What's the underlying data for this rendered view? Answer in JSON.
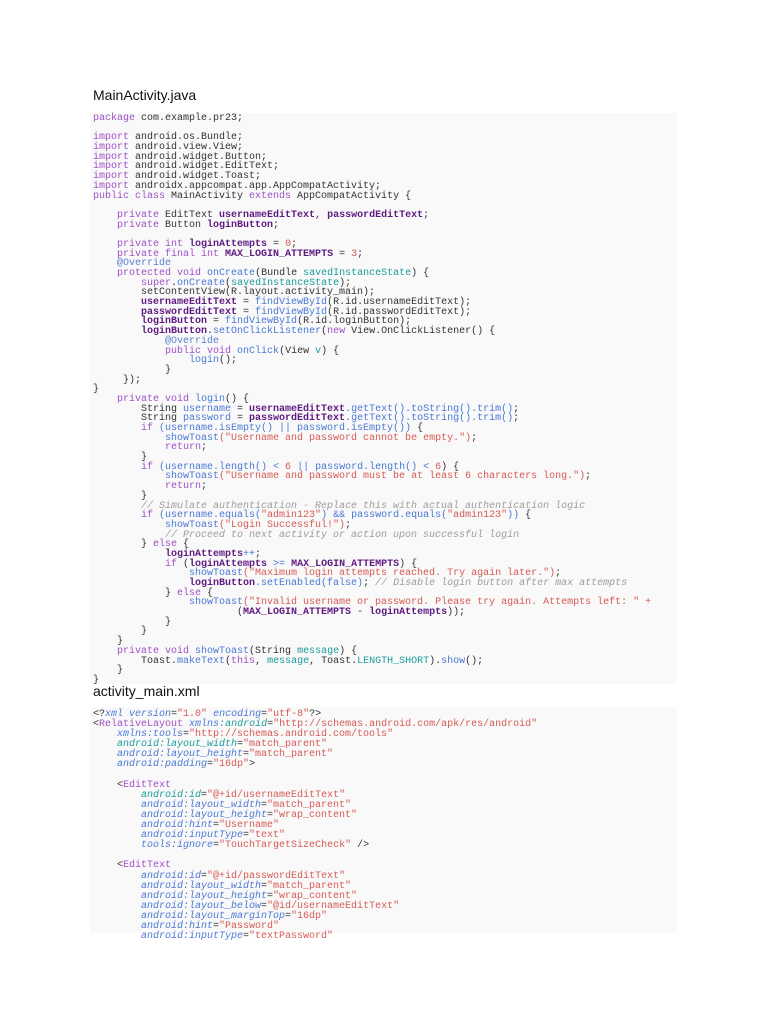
{
  "java": {
    "title": "MainActivity.java",
    "lines": [
      [
        [
          "k",
          "package"
        ],
        [
          "p",
          " com.example.pr23;"
        ]
      ],
      [],
      [
        [
          "k",
          "import"
        ],
        [
          "p",
          " android.os.Bundle;"
        ]
      ],
      [
        [
          "k",
          "import"
        ],
        [
          "p",
          " android.view.View;"
        ]
      ],
      [
        [
          "k",
          "import"
        ],
        [
          "p",
          " android.widget.Button;"
        ]
      ],
      [
        [
          "k",
          "import"
        ],
        [
          "p",
          " android.widget.EditText;"
        ]
      ],
      [
        [
          "k",
          "import"
        ],
        [
          "p",
          " android.widget.Toast;"
        ]
      ],
      [
        [
          "k",
          "import"
        ],
        [
          "p",
          " androidx.appcompat.app.AppCompatActivity;"
        ]
      ],
      [
        [
          "k",
          "public class"
        ],
        [
          "p",
          " MainActivity "
        ],
        [
          "k",
          "extends"
        ],
        [
          "p",
          " AppCompatActivity {"
        ]
      ],
      [],
      [
        [
          "k",
          "    private"
        ],
        [
          "p",
          " EditText "
        ],
        [
          "f",
          "usernameEditText"
        ],
        [
          "p",
          ", "
        ],
        [
          "f",
          "passwordEditText"
        ],
        [
          "p",
          ";"
        ]
      ],
      [
        [
          "k",
          "    private"
        ],
        [
          "p",
          " Button "
        ],
        [
          "f",
          "loginButton"
        ],
        [
          "p",
          ";"
        ]
      ],
      [],
      [
        [
          "k",
          "    private int"
        ],
        [
          "p",
          " "
        ],
        [
          "f",
          "loginAttempts"
        ],
        [
          "p",
          " = "
        ],
        [
          "n",
          "0"
        ],
        [
          "p",
          ";"
        ]
      ],
      [
        [
          "k",
          "    private final int"
        ],
        [
          "p",
          " "
        ],
        [
          "f",
          "MAX_LOGIN_ATTEMPTS"
        ],
        [
          "p",
          " = "
        ],
        [
          "n",
          "3"
        ],
        [
          "p",
          ";"
        ]
      ],
      [
        [
          "o",
          "    @Override"
        ]
      ],
      [
        [
          "k",
          "    protected void"
        ],
        [
          "p",
          " "
        ],
        [
          "m",
          "onCreate"
        ],
        [
          "p",
          "(Bundle "
        ],
        [
          "a",
          "savedInstanceState"
        ],
        [
          "p",
          ") {"
        ]
      ],
      [
        [
          "k",
          "        super"
        ],
        [
          "p",
          "."
        ],
        [
          "m",
          "onCreate"
        ],
        [
          "p",
          "("
        ],
        [
          "a",
          "savedInstanceState"
        ],
        [
          "p",
          ");"
        ]
      ],
      [
        [
          "p",
          "        setContentView(R.layout.activity_main);"
        ]
      ],
      [
        [
          "f",
          "        usernameEditText"
        ],
        [
          "p",
          " = "
        ],
        [
          "m",
          "findViewById"
        ],
        [
          "p",
          "(R.id.usernameEditText);"
        ]
      ],
      [
        [
          "f",
          "        passwordEditText"
        ],
        [
          "p",
          " = "
        ],
        [
          "m",
          "findViewById"
        ],
        [
          "p",
          "(R.id.passwordEditText);"
        ]
      ],
      [
        [
          "f",
          "        loginButton"
        ],
        [
          "p",
          " = "
        ],
        [
          "m",
          "findViewById"
        ],
        [
          "p",
          "(R.id.loginButton);"
        ]
      ],
      [
        [
          "f",
          "        loginButton"
        ],
        [
          "p",
          "."
        ],
        [
          "m",
          "setOnClickListener"
        ],
        [
          "p",
          "("
        ],
        [
          "k",
          "new"
        ],
        [
          "p",
          " View.OnClickListener() {"
        ]
      ],
      [
        [
          "o",
          "            @Override"
        ]
      ],
      [
        [
          "k",
          "            public void"
        ],
        [
          "p",
          " "
        ],
        [
          "m",
          "onClick"
        ],
        [
          "p",
          "(View "
        ],
        [
          "a",
          "v"
        ],
        [
          "p",
          ") {"
        ]
      ],
      [
        [
          "m",
          "                login"
        ],
        [
          "p",
          "();"
        ]
      ],
      [
        [
          "p",
          "            }"
        ]
      ],
      [
        [
          "p",
          "     });"
        ]
      ],
      [
        [
          "p",
          "}"
        ]
      ],
      [
        [
          "k",
          "    private void"
        ],
        [
          "p",
          " "
        ],
        [
          "m",
          "login"
        ],
        [
          "p",
          "() {"
        ]
      ],
      [
        [
          "p",
          "        String "
        ],
        [
          "m",
          "username"
        ],
        [
          "p",
          " = "
        ],
        [
          "f",
          "usernameEditText"
        ],
        [
          "m",
          ".getText().toString().trim()"
        ],
        [
          "p",
          ";"
        ]
      ],
      [
        [
          "p",
          "        String "
        ],
        [
          "m",
          "password"
        ],
        [
          "p",
          " = "
        ],
        [
          "f",
          "passwordEditText"
        ],
        [
          "m",
          ".getText().toString().trim()"
        ],
        [
          "p",
          ";"
        ]
      ],
      [
        [
          "k",
          "        if"
        ],
        [
          "m",
          " (username.isEmpty() || password.isEmpty())"
        ],
        [
          "p",
          " {"
        ]
      ],
      [
        [
          "m",
          "            showToast"
        ],
        [
          "s",
          "(\"Username and password cannot be empty.\")"
        ],
        [
          "p",
          ";"
        ]
      ],
      [
        [
          "k",
          "            return"
        ],
        [
          "p",
          ";"
        ]
      ],
      [
        [
          "p",
          "        }"
        ]
      ],
      [
        [
          "k",
          "        if"
        ],
        [
          "m",
          " (username.length() < "
        ],
        [
          "n",
          "6"
        ],
        [
          "m",
          " || password.length() < "
        ],
        [
          "n",
          "6"
        ],
        [
          "p",
          ") {"
        ]
      ],
      [
        [
          "m",
          "            showToast"
        ],
        [
          "s",
          "(\"Username and password must be at least 6 characters long.\")"
        ],
        [
          "p",
          ";"
        ]
      ],
      [
        [
          "k",
          "            return"
        ],
        [
          "p",
          ";"
        ]
      ],
      [
        [
          "p",
          "        }"
        ]
      ],
      [
        [
          "c",
          "        // Simulate authentication - Replace this with actual authentication logic"
        ]
      ],
      [
        [
          "k",
          "        if"
        ],
        [
          "m",
          " (username.equals("
        ],
        [
          "s",
          "\"admin123\""
        ],
        [
          "m",
          ") && password.equals("
        ],
        [
          "s",
          "\"admin123\""
        ],
        [
          "m",
          "))"
        ],
        [
          "p",
          " {"
        ]
      ],
      [
        [
          "m",
          "            showToast"
        ],
        [
          "s",
          "(\"Login Successful!\")"
        ],
        [
          "p",
          ";"
        ]
      ],
      [
        [
          "c",
          "            // Proceed to next activity or action upon successful login"
        ]
      ],
      [
        [
          "p",
          "        } "
        ],
        [
          "k",
          "else"
        ],
        [
          "p",
          " {"
        ]
      ],
      [
        [
          "f",
          "            loginAttempts"
        ],
        [
          "m",
          "++"
        ],
        [
          "p",
          ";"
        ]
      ],
      [
        [
          "k",
          "            if"
        ],
        [
          "p",
          " ("
        ],
        [
          "f",
          "loginAttempts"
        ],
        [
          "m",
          " >= "
        ],
        [
          "f",
          "MAX_LOGIN_ATTEMPTS"
        ],
        [
          "p",
          ") {"
        ]
      ],
      [
        [
          "m",
          "                showToast"
        ],
        [
          "s",
          "(\"Maximum login attempts reached. Try again later.\")"
        ],
        [
          "p",
          ";"
        ]
      ],
      [
        [
          "f",
          "                loginButton"
        ],
        [
          "m",
          ".setEnabled(false)"
        ],
        [
          "p",
          "; "
        ],
        [
          "c",
          "// Disable login button after max attempts"
        ]
      ],
      [
        [
          "p",
          "            } "
        ],
        [
          "k",
          "else"
        ],
        [
          "p",
          " {"
        ]
      ],
      [
        [
          "m",
          "                showToast"
        ],
        [
          "s",
          "(\"Invalid username or password. Please try again. Attempts left: \" +"
        ]
      ],
      [
        [
          "p",
          "                        ("
        ],
        [
          "f",
          "MAX_LOGIN_ATTEMPTS"
        ],
        [
          "p",
          " - "
        ],
        [
          "f",
          "loginAttempts"
        ],
        [
          "p",
          "));"
        ]
      ],
      [
        [
          "p",
          "            }"
        ]
      ],
      [
        [
          "p",
          "        }"
        ]
      ],
      [
        [
          "p",
          "    }"
        ]
      ],
      [
        [
          "k",
          "    private void"
        ],
        [
          "p",
          " "
        ],
        [
          "m",
          "showToast"
        ],
        [
          "p",
          "(String "
        ],
        [
          "a",
          "message"
        ],
        [
          "p",
          ") {"
        ]
      ],
      [
        [
          "p",
          "        Toast."
        ],
        [
          "m",
          "makeText"
        ],
        [
          "p",
          "("
        ],
        [
          "k",
          "this"
        ],
        [
          "p",
          ", "
        ],
        [
          "a",
          "message"
        ],
        [
          "p",
          ", Toast."
        ],
        [
          "a",
          "LENGTH_SHORT"
        ],
        [
          "p",
          ")."
        ],
        [
          "m",
          "show"
        ],
        [
          "p",
          "();"
        ]
      ],
      [
        [
          "p",
          "    }"
        ]
      ],
      [
        [
          "p",
          "}"
        ]
      ]
    ]
  },
  "xml": {
    "title": "activity_main.xml",
    "lines": [
      [
        [
          "p",
          "<?"
        ],
        [
          "an",
          "xml version"
        ],
        [
          "p",
          "="
        ],
        [
          "s",
          "\"1.0\""
        ],
        [
          "p",
          " "
        ],
        [
          "an",
          "encoding"
        ],
        [
          "p",
          "="
        ],
        [
          "s",
          "\"utf-8\""
        ],
        [
          "p",
          "?>"
        ]
      ],
      [
        [
          "p",
          "<"
        ],
        [
          "tg",
          "RelativeLayout"
        ],
        [
          "p",
          " "
        ],
        [
          "an",
          "xmlns:"
        ],
        [
          "at",
          "android"
        ],
        [
          "p",
          "="
        ],
        [
          "s",
          "\"http://schemas.android.com/apk/res/android\""
        ]
      ],
      [
        [
          "an",
          "    xmlns:tools"
        ],
        [
          "p",
          "="
        ],
        [
          "s",
          "\"http://schemas.android.com/tools\""
        ]
      ],
      [
        [
          "at",
          "    android:layout_width"
        ],
        [
          "p",
          "="
        ],
        [
          "s",
          "\"match_parent\""
        ]
      ],
      [
        [
          "an",
          "    android:layout_height"
        ],
        [
          "p",
          "="
        ],
        [
          "s",
          "\"match_parent\""
        ]
      ],
      [
        [
          "an",
          "    android:padding"
        ],
        [
          "p",
          "="
        ],
        [
          "s",
          "\"16dp\""
        ],
        [
          "p",
          ">"
        ]
      ],
      [],
      [
        [
          "p",
          "    <"
        ],
        [
          "tg",
          "EditText"
        ]
      ],
      [
        [
          "at",
          "        android:id"
        ],
        [
          "p",
          "="
        ],
        [
          "s",
          "\"@+id/usernameEditText\""
        ]
      ],
      [
        [
          "an",
          "        android:layout_width"
        ],
        [
          "p",
          "="
        ],
        [
          "s",
          "\"match_parent\""
        ]
      ],
      [
        [
          "an",
          "        android:layout_height"
        ],
        [
          "p",
          "="
        ],
        [
          "s",
          "\"wrap_content\""
        ]
      ],
      [
        [
          "an",
          "        android:hint"
        ],
        [
          "p",
          "="
        ],
        [
          "s",
          "\"Username\""
        ]
      ],
      [
        [
          "an",
          "        android:inputType"
        ],
        [
          "p",
          "="
        ],
        [
          "s",
          "\"text\""
        ]
      ],
      [
        [
          "an",
          "        tools:ignore"
        ],
        [
          "p",
          "="
        ],
        [
          "s",
          "\"TouchTargetSizeCheck\""
        ],
        [
          "p",
          " />"
        ]
      ],
      [],
      [
        [
          "p",
          "    <"
        ],
        [
          "tg",
          "EditText"
        ]
      ],
      [
        [
          "an",
          "        android:id"
        ],
        [
          "p",
          "="
        ],
        [
          "s",
          "\"@+id/passwordEditText\""
        ]
      ],
      [
        [
          "an",
          "        android:layout_width"
        ],
        [
          "p",
          "="
        ],
        [
          "s",
          "\"match_parent\""
        ]
      ],
      [
        [
          "an",
          "        android:layout_height"
        ],
        [
          "p",
          "="
        ],
        [
          "s",
          "\"wrap_content\""
        ]
      ],
      [
        [
          "an",
          "        android:layout_below"
        ],
        [
          "p",
          "="
        ],
        [
          "s",
          "\"@id/usernameEditText\""
        ]
      ],
      [
        [
          "an",
          "        android:layout_marginTop"
        ],
        [
          "p",
          "="
        ],
        [
          "s",
          "\"16dp\""
        ]
      ],
      [
        [
          "an",
          "        android:hint"
        ],
        [
          "p",
          "="
        ],
        [
          "s",
          "\"Password\""
        ]
      ],
      [
        [
          "an",
          "        android:inputType"
        ],
        [
          "p",
          "="
        ],
        [
          "s",
          "\"textPassword\""
        ]
      ]
    ]
  }
}
